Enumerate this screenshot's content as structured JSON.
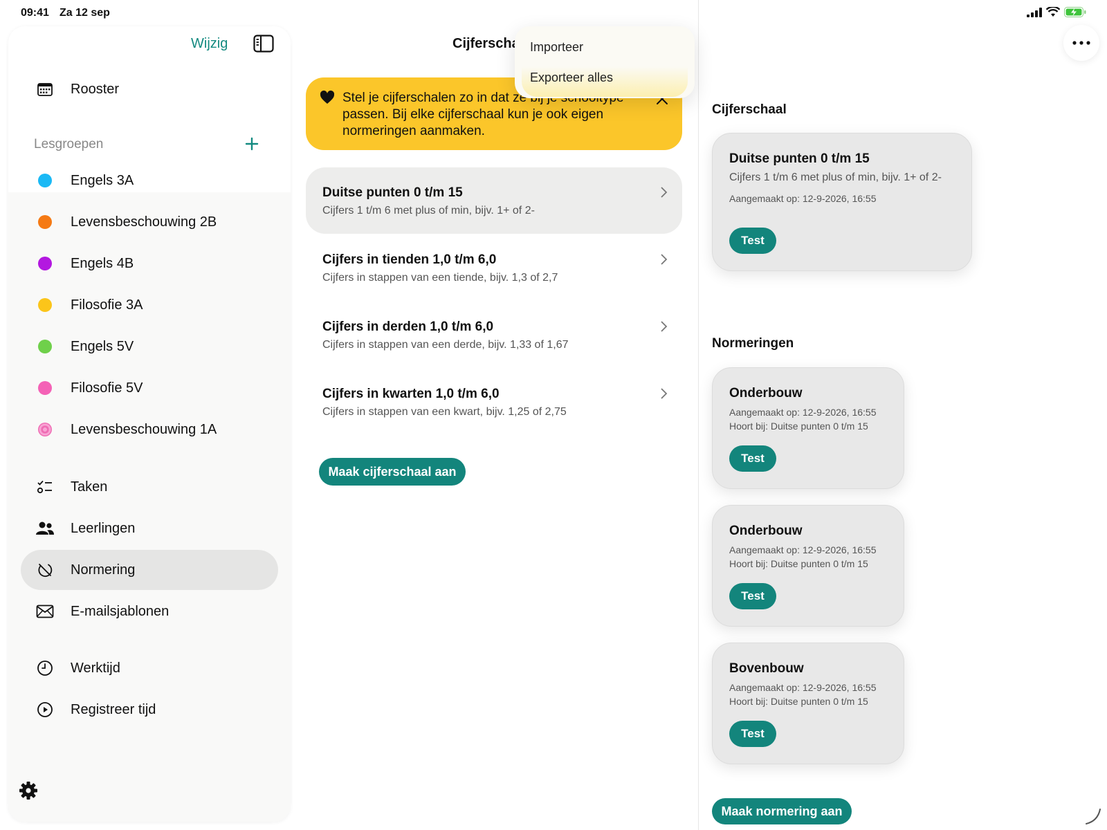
{
  "status": {
    "time": "09:41",
    "date": "Za 12 sep"
  },
  "sidebar": {
    "edit_label": "Wijzig",
    "top_items": [
      {
        "label": "Rooster",
        "icon": "calendar-icon"
      }
    ],
    "section_label": "Lesgroepen",
    "groups": [
      {
        "label": "Engels 3A",
        "color": "#1ab9f5"
      },
      {
        "label": "Levensbeschouwing 2B",
        "color": "#f57a14"
      },
      {
        "label": "Engels 4B",
        "color": "#b318e0"
      },
      {
        "label": "Filosofie 3A",
        "color": "#fbc51a"
      },
      {
        "label": "Engels 5V",
        "color": "#6fd04a"
      },
      {
        "label": "Filosofie 5V",
        "color": "#f462b6"
      },
      {
        "label": "Levensbeschouwing 1A",
        "color": "#ef6db4"
      }
    ],
    "tools": [
      {
        "label": "Taken",
        "icon": "tasks-icon"
      },
      {
        "label": "Leerlingen",
        "icon": "students-icon"
      },
      {
        "label": "Normering",
        "icon": "grading-icon"
      },
      {
        "label": "E-mailsjablonen",
        "icon": "mail-icon"
      }
    ],
    "time_items": [
      {
        "label": "Werktijd",
        "icon": "clock-icon"
      },
      {
        "label": "Registreer tijd",
        "icon": "play-icon"
      }
    ]
  },
  "middle": {
    "title": "Cijferscha",
    "banner_text": "Stel je cijferschalen zo in dat ze bij je schooltype passen. Bij elke cijferschaal kun je ook eigen normeringen aanmaken.",
    "scales": [
      {
        "title": "Duitse punten 0 t/m 15",
        "subtitle": "Cijfers 1 t/m 6 met plus of min, bijv. 1+ of 2-"
      },
      {
        "title": "Cijfers in tienden 1,0 t/m 6,0",
        "subtitle": "Cijfers in stappen van een tiende, bijv. 1,3 of 2,7"
      },
      {
        "title": "Cijfers in derden 1,0 t/m 6,0",
        "subtitle": "Cijfers in stappen van een derde, bijv. 1,33 of 1,67"
      },
      {
        "title": "Cijfers in kwarten 1,0 t/m 6,0",
        "subtitle": "Cijfers in stappen van een kwart, bijv. 1,25 of 2,75"
      }
    ],
    "create_label": "Maak cijferschaal aan"
  },
  "menu": {
    "items": [
      "Importeer",
      "Exporteer alles"
    ]
  },
  "detail": {
    "scale_heading": "Cijferschaal",
    "scale_card": {
      "title": "Duitse punten 0 t/m 15",
      "subtitle": "Cijfers 1 t/m 6 met plus of min, bijv. 1+ of 2-",
      "created": "Aangemaakt op: 12-9-2026, 16:55",
      "badge": "Test"
    },
    "norm_heading": "Normeringen",
    "norms": [
      {
        "title": "Onderbouw",
        "created": "Aangemaakt op: 12-9-2026, 16:55",
        "belongs": "Hoort bij: Duitse punten 0 t/m 15",
        "badge": "Test"
      },
      {
        "title": "Onderbouw",
        "created": "Aangemaakt op: 12-9-2026, 16:55",
        "belongs": "Hoort bij: Duitse punten 0 t/m 15",
        "badge": "Test"
      },
      {
        "title": "Bovenbouw",
        "created": "Aangemaakt op: 12-9-2026, 16:55",
        "belongs": "Hoort bij: Duitse punten 0 t/m 15",
        "badge": "Test"
      }
    ],
    "create_label": "Maak normering aan"
  },
  "colors": {
    "accent": "#13857c",
    "banner": "#fbc62a"
  }
}
